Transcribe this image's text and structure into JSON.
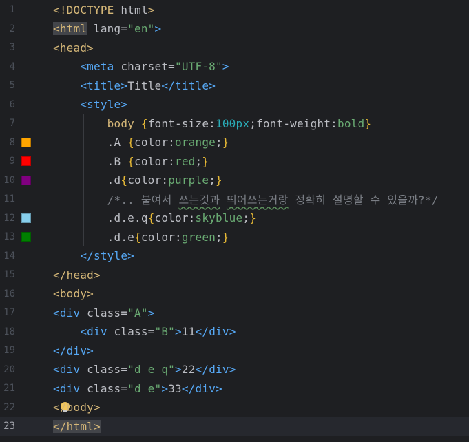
{
  "editor": {
    "lines": [
      {
        "n": "1",
        "segments": [
          [
            "tag",
            "<!DOCTYPE "
          ],
          [
            "attr",
            "html"
          ],
          [
            "tag",
            ">"
          ]
        ]
      },
      {
        "n": "2",
        "segments": [
          [
            "tagsel",
            "<html"
          ],
          [
            "attr",
            " lang="
          ],
          [
            "str",
            "\"en\""
          ],
          [
            "tagb",
            ">"
          ]
        ]
      },
      {
        "n": "3",
        "segments": [
          [
            "tag",
            "<head>"
          ]
        ]
      },
      {
        "n": "4",
        "segments": [
          [
            "text",
            "    "
          ],
          [
            "tagb",
            "<meta "
          ],
          [
            "attr",
            "charset="
          ],
          [
            "str",
            "\"UTF-8\""
          ],
          [
            "tagb",
            ">"
          ]
        ]
      },
      {
        "n": "5",
        "segments": [
          [
            "text",
            "    "
          ],
          [
            "tagb",
            "<title>"
          ],
          [
            "text",
            "Title"
          ],
          [
            "tagb",
            "</title>"
          ]
        ]
      },
      {
        "n": "6",
        "segments": [
          [
            "text",
            "    "
          ],
          [
            "tagb",
            "<style>"
          ]
        ]
      },
      {
        "n": "7",
        "segments": [
          [
            "text",
            "        "
          ],
          [
            "sel",
            "body "
          ],
          [
            "brace",
            "{"
          ],
          [
            "prop",
            "font-size:"
          ],
          [
            "valnum",
            "100px"
          ],
          [
            "prop",
            ";font-weight:"
          ],
          [
            "val",
            "bold"
          ],
          [
            "brace",
            "}"
          ]
        ]
      },
      {
        "n": "8",
        "swatch": "#ffa500",
        "segments": [
          [
            "text",
            "        "
          ],
          [
            "prop",
            ".A "
          ],
          [
            "brace",
            "{"
          ],
          [
            "prop",
            "color:"
          ],
          [
            "val",
            "orange"
          ],
          [
            "prop",
            ";"
          ],
          [
            "brace",
            "}"
          ]
        ]
      },
      {
        "n": "9",
        "swatch": "#ff0000",
        "segments": [
          [
            "text",
            "        "
          ],
          [
            "prop",
            ".B "
          ],
          [
            "brace",
            "{"
          ],
          [
            "prop",
            "color:"
          ],
          [
            "val",
            "red"
          ],
          [
            "prop",
            ";"
          ],
          [
            "brace",
            "}"
          ]
        ]
      },
      {
        "n": "10",
        "swatch": "#800080",
        "segments": [
          [
            "text",
            "        "
          ],
          [
            "prop",
            ".d"
          ],
          [
            "brace",
            "{"
          ],
          [
            "prop",
            "color:"
          ],
          [
            "val",
            "purple"
          ],
          [
            "prop",
            ";"
          ],
          [
            "brace",
            "}"
          ]
        ]
      },
      {
        "n": "11",
        "segments": [
          [
            "text",
            "        "
          ],
          [
            "comment",
            "/*.. 붙여서 "
          ],
          [
            "commenttypo",
            "쓰는것과"
          ],
          [
            "comment",
            " "
          ],
          [
            "commenttypo",
            "띄어쓰는거랑"
          ],
          [
            "comment",
            " 정확히 설명할 수 있을까?*/"
          ]
        ]
      },
      {
        "n": "12",
        "swatch": "#87ceeb",
        "segments": [
          [
            "text",
            "        "
          ],
          [
            "prop",
            ".d.e.q"
          ],
          [
            "brace",
            "{"
          ],
          [
            "prop",
            "color:"
          ],
          [
            "val",
            "skyblue"
          ],
          [
            "prop",
            ";"
          ],
          [
            "brace",
            "}"
          ]
        ]
      },
      {
        "n": "13",
        "swatch": "#008000",
        "segments": [
          [
            "text",
            "        "
          ],
          [
            "prop",
            ".d.e"
          ],
          [
            "brace",
            "{"
          ],
          [
            "prop",
            "color:"
          ],
          [
            "val",
            "green"
          ],
          [
            "prop",
            ";"
          ],
          [
            "brace",
            "}"
          ]
        ]
      },
      {
        "n": "14",
        "segments": [
          [
            "text",
            "    "
          ],
          [
            "tagb",
            "</style>"
          ]
        ]
      },
      {
        "n": "15",
        "segments": [
          [
            "tag",
            "</head>"
          ]
        ]
      },
      {
        "n": "16",
        "segments": [
          [
            "tag",
            "<body>"
          ]
        ]
      },
      {
        "n": "17",
        "segments": [
          [
            "tagb",
            "<div "
          ],
          [
            "attr",
            "class="
          ],
          [
            "str",
            "\"A\""
          ],
          [
            "tagb",
            ">"
          ]
        ]
      },
      {
        "n": "18",
        "segments": [
          [
            "text",
            "    "
          ],
          [
            "tagb",
            "<div "
          ],
          [
            "attr",
            "class="
          ],
          [
            "str",
            "\"B\""
          ],
          [
            "tagb",
            ">"
          ],
          [
            "text",
            "11"
          ],
          [
            "tagb",
            "</div>"
          ]
        ]
      },
      {
        "n": "19",
        "segments": [
          [
            "tagb",
            "</div>"
          ]
        ]
      },
      {
        "n": "20",
        "segments": [
          [
            "tagb",
            "<div "
          ],
          [
            "attr",
            "class="
          ],
          [
            "str",
            "\"d e q\""
          ],
          [
            "tagb",
            ">"
          ],
          [
            "text",
            "22"
          ],
          [
            "tagb",
            "</div>"
          ]
        ]
      },
      {
        "n": "21",
        "segments": [
          [
            "tagb",
            "<div "
          ],
          [
            "attr",
            "class="
          ],
          [
            "str",
            "\"d e\""
          ],
          [
            "tagb",
            ">"
          ],
          [
            "text",
            "33"
          ],
          [
            "tagb",
            "</div>"
          ]
        ]
      },
      {
        "n": "22",
        "bulb": true,
        "segments": [
          [
            "tag",
            "</body>"
          ]
        ]
      },
      {
        "n": "23",
        "current": true,
        "segments": [
          [
            "tagsel",
            "</html>"
          ]
        ]
      }
    ]
  },
  "colors": {
    "background": "#1e1f22",
    "tag": "#d5b778",
    "tag_blue": "#56a8f5",
    "string": "#6aab73",
    "number": "#2aacb8",
    "comment": "#7a7e85"
  },
  "icons": {
    "intention_action": "lightbulb-icon"
  }
}
